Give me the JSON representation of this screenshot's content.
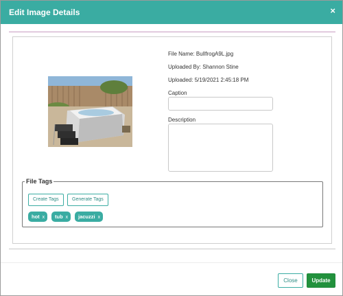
{
  "dialog": {
    "title": "Edit Image Details",
    "close_glyph": "×",
    "accent_color": "#3aaca2"
  },
  "image": {
    "file_name": "File Name: BullfrogA9L.jpg",
    "uploaded_by": "Uploaded By: Shannon Stine",
    "uploaded": "Uploaded: 5/19/2021 2:45:18 PM"
  },
  "fields": {
    "caption_label": "Caption",
    "caption_value": "",
    "description_label": "Description",
    "description_value": ""
  },
  "tags": {
    "legend": "File Tags",
    "create_label": "Create Tags",
    "generate_label": "Generate Tags",
    "remove_glyph": "x",
    "items": [
      "hot",
      "tub",
      "jacuzzi"
    ]
  },
  "footer": {
    "close_label": "Close",
    "update_label": "Update",
    "update_color": "#22913d"
  }
}
